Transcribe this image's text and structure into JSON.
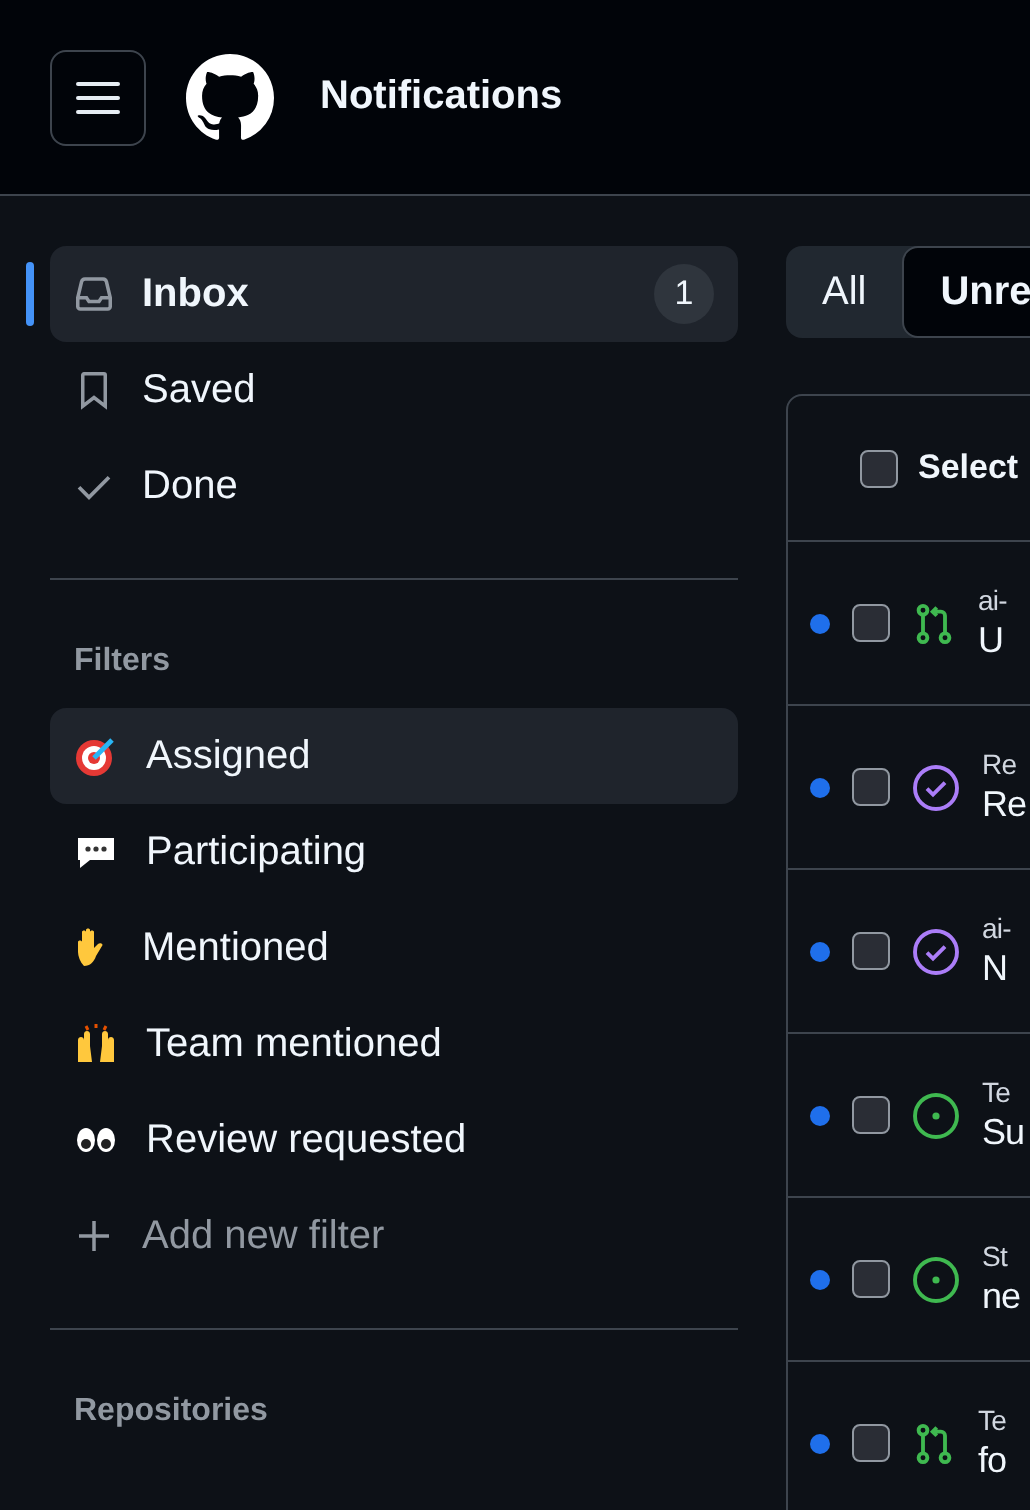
{
  "header": {
    "title": "Notifications"
  },
  "sidebar": {
    "items": [
      {
        "label": "Inbox",
        "count": "1",
        "selected": true
      },
      {
        "label": "Saved",
        "selected": false
      },
      {
        "label": "Done",
        "selected": false
      }
    ],
    "filters_heading": "Filters",
    "filters": [
      {
        "label": "Assigned",
        "selected": true
      },
      {
        "label": "Participating",
        "selected": false
      },
      {
        "label": "Mentioned",
        "selected": false
      },
      {
        "label": "Team mentioned",
        "selected": false
      },
      {
        "label": "Review requested",
        "selected": false
      }
    ],
    "add_filter": "Add new filter",
    "repositories_heading": "Repositories"
  },
  "view_tabs": [
    {
      "label": "All",
      "selected": false
    },
    {
      "label": "Unre",
      "selected": true
    }
  ],
  "table": {
    "select_label": "Select",
    "select_checked": false,
    "rows": [
      {
        "kind": "pull-request",
        "unread": true,
        "checked": false,
        "repo": "ai-",
        "title": "U"
      },
      {
        "kind": "done",
        "unread": true,
        "checked": false,
        "repo": "Re",
        "title": "Re"
      },
      {
        "kind": "done",
        "unread": true,
        "checked": false,
        "repo": "ai-",
        "title": "N"
      },
      {
        "kind": "issue",
        "unread": true,
        "checked": false,
        "repo": "Te",
        "title": "Su"
      },
      {
        "kind": "issue",
        "unread": true,
        "checked": false,
        "repo": "St",
        "title": "ne"
      },
      {
        "kind": "pull-request",
        "unread": true,
        "checked": false,
        "repo": "Te",
        "title": "fo"
      }
    ]
  }
}
